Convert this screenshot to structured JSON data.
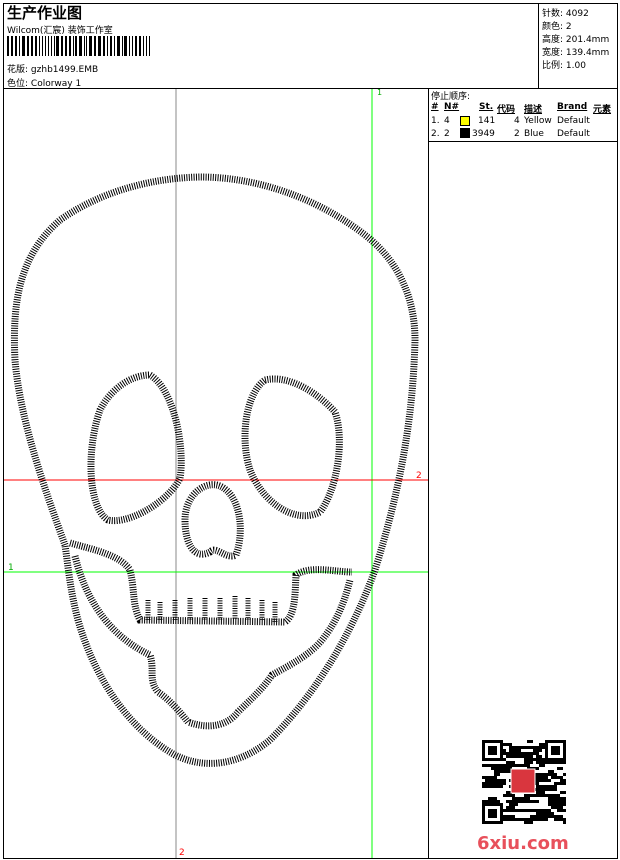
{
  "header": {
    "title": "生产作业图",
    "company": "Wilcom(汇宸) 装饰工作室",
    "design_label": "花版:",
    "design_value": "gzhb1499.EMB",
    "colorway_label": "色位:",
    "colorway_value": "Colorway 1"
  },
  "info": [
    {
      "label": "针数:",
      "value": "4092"
    },
    {
      "label": "颜色:",
      "value": "2"
    },
    {
      "label": "高度:",
      "value": "201.4mm"
    },
    {
      "label": "宽度:",
      "value": "139.4mm"
    },
    {
      "label": "比例:",
      "value": "1.00"
    }
  ],
  "stops": {
    "title": "停止顺序:",
    "headers": [
      "#",
      "N#",
      "St.",
      "代码",
      "描述",
      "Brand",
      "元素"
    ],
    "rows": [
      {
        "idx": "1.",
        "n": "4",
        "color": "#ffff00",
        "st": "141",
        "code": "4",
        "desc": "Yellow",
        "brand": "Default"
      },
      {
        "idx": "2.",
        "n": "2",
        "color": "#000000",
        "st": "3949",
        "code": "2",
        "desc": "Blue",
        "brand": "Default"
      }
    ]
  },
  "guides": {
    "v_green": "1",
    "h_red": "2",
    "h_green": "1",
    "v_gray": "2",
    "green": "#00ff00",
    "red": "#ff0000"
  },
  "watermark": {
    "text": "6xiu.com"
  }
}
